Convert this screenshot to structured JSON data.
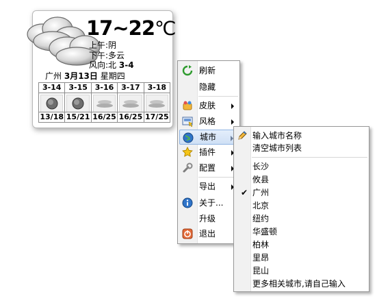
{
  "widget": {
    "temp_range": "17~22",
    "temp_unit": "℃",
    "morning": "上午:阴",
    "afternoon": "下午:多云",
    "wind_label": "风向:北",
    "wind_level": "3-4",
    "date_city": "广州",
    "date_day": "3月13日",
    "date_weekday": "星期四",
    "forecast": [
      {
        "date": "3-14",
        "temp": "13/18",
        "icon": "cloudy-moon-icon"
      },
      {
        "date": "3-15",
        "temp": "15/21",
        "icon": "cloudy-moon-icon"
      },
      {
        "date": "3-16",
        "temp": "16/25",
        "icon": "fog-icon"
      },
      {
        "date": "3-17",
        "temp": "16/25",
        "icon": "fog-icon"
      },
      {
        "date": "3-18",
        "temp": "17/25",
        "icon": "fog-icon"
      }
    ]
  },
  "context_menu": {
    "refresh": "刷新",
    "hide": "隐藏",
    "skin": "皮肤",
    "style": "风格",
    "city": "城市",
    "plugins": "插件",
    "config": "配置",
    "export": "导出",
    "about": "关于...",
    "upgrade": "升级",
    "exit": "退出"
  },
  "city_menu": {
    "enter_city": "输入城市名称",
    "clear_list": "清空城市列表",
    "cities": [
      "长沙",
      "攸县",
      "广州",
      "北京",
      "纽约",
      "华盛顿",
      "柏林",
      "里昂",
      "昆山"
    ],
    "checked_city": "广州",
    "more": "更多相关城市,请自己输入"
  },
  "colors": {
    "highlight_border": "#8fb4e3",
    "highlight_fill": "#cfe0f5",
    "menu_border": "#979797"
  }
}
